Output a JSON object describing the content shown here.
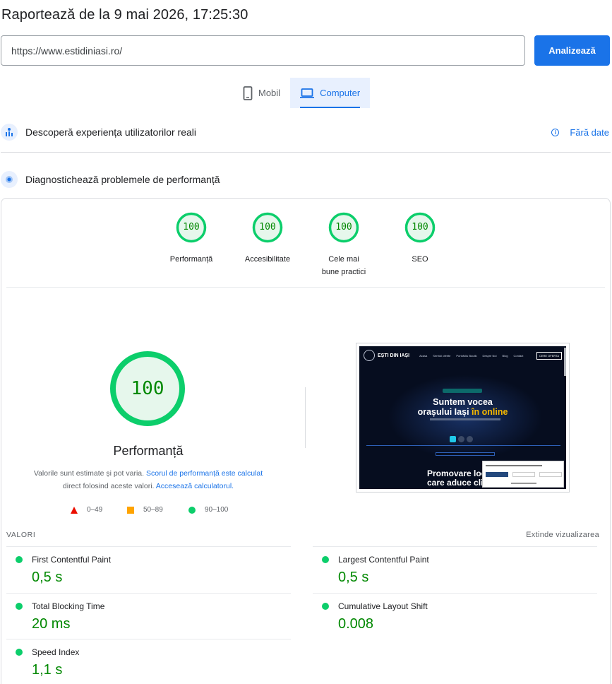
{
  "header": {
    "title": "Raportează de la 9 mai 2026, 17:25:30"
  },
  "search": {
    "url": "https://www.estidiniasi.ro/",
    "analyze_label": "Analizează"
  },
  "device_tabs": [
    {
      "label": "Mobil",
      "icon": "phone-icon",
      "active": false
    },
    {
      "label": "Computer",
      "icon": "laptop-icon",
      "active": true
    }
  ],
  "crux": {
    "title": "Descoperă experiența utilizatorilor reali",
    "no_data": "Fără date"
  },
  "diagnose": {
    "title": "Diagnostichează problemele de performanță"
  },
  "categories": [
    {
      "label": "Performanță",
      "score": "100"
    },
    {
      "label": "Accesibilitate",
      "score": "100"
    },
    {
      "label": "Cele mai bune practici",
      "score": "100"
    },
    {
      "label": "SEO",
      "score": "100"
    }
  ],
  "performance": {
    "score": "100",
    "label": "Performanță",
    "note_prefix": "Valorile sunt estimate și pot varia. ",
    "note_link1": "Scorul de performanță este calculat",
    "note_middle": " direct folosind aceste valori. ",
    "note_link2": "Accesează calculatorul."
  },
  "legend": {
    "bad": "0–49",
    "average": "50–89",
    "good": "90–100"
  },
  "screenshot": {
    "brand": "EȘTI DIN IAȘI",
    "menu": [
      "Acasa",
      "Servicii oferite",
      "Portofoliu Boutik",
      "Despre Noi",
      "Blog",
      "Contact"
    ],
    "cta": "CERE OFERTA",
    "headline_1": "Suntem vocea",
    "headline_2a": "orașului Iași ",
    "headline_2b": "în online",
    "headline_3": "Promovare loc",
    "headline_4": "care aduce cli"
  },
  "metrics": {
    "header": "VALORI",
    "expand": "Extinde vizualizarea",
    "items": [
      {
        "name": "First Contentful Paint",
        "value": "0,5 s"
      },
      {
        "name": "Largest Contentful Paint",
        "value": "0,5 s"
      },
      {
        "name": "Total Blocking Time",
        "value": "20 ms"
      },
      {
        "name": "Cumulative Layout Shift",
        "value": "0.008"
      },
      {
        "name": "Speed Index",
        "value": "1,1 s"
      }
    ]
  },
  "colors": {
    "accent": "#1a73e8",
    "good": "#0cce6b",
    "good_text": "#008800",
    "average": "#ffa400",
    "bad": "#eb0f00"
  }
}
